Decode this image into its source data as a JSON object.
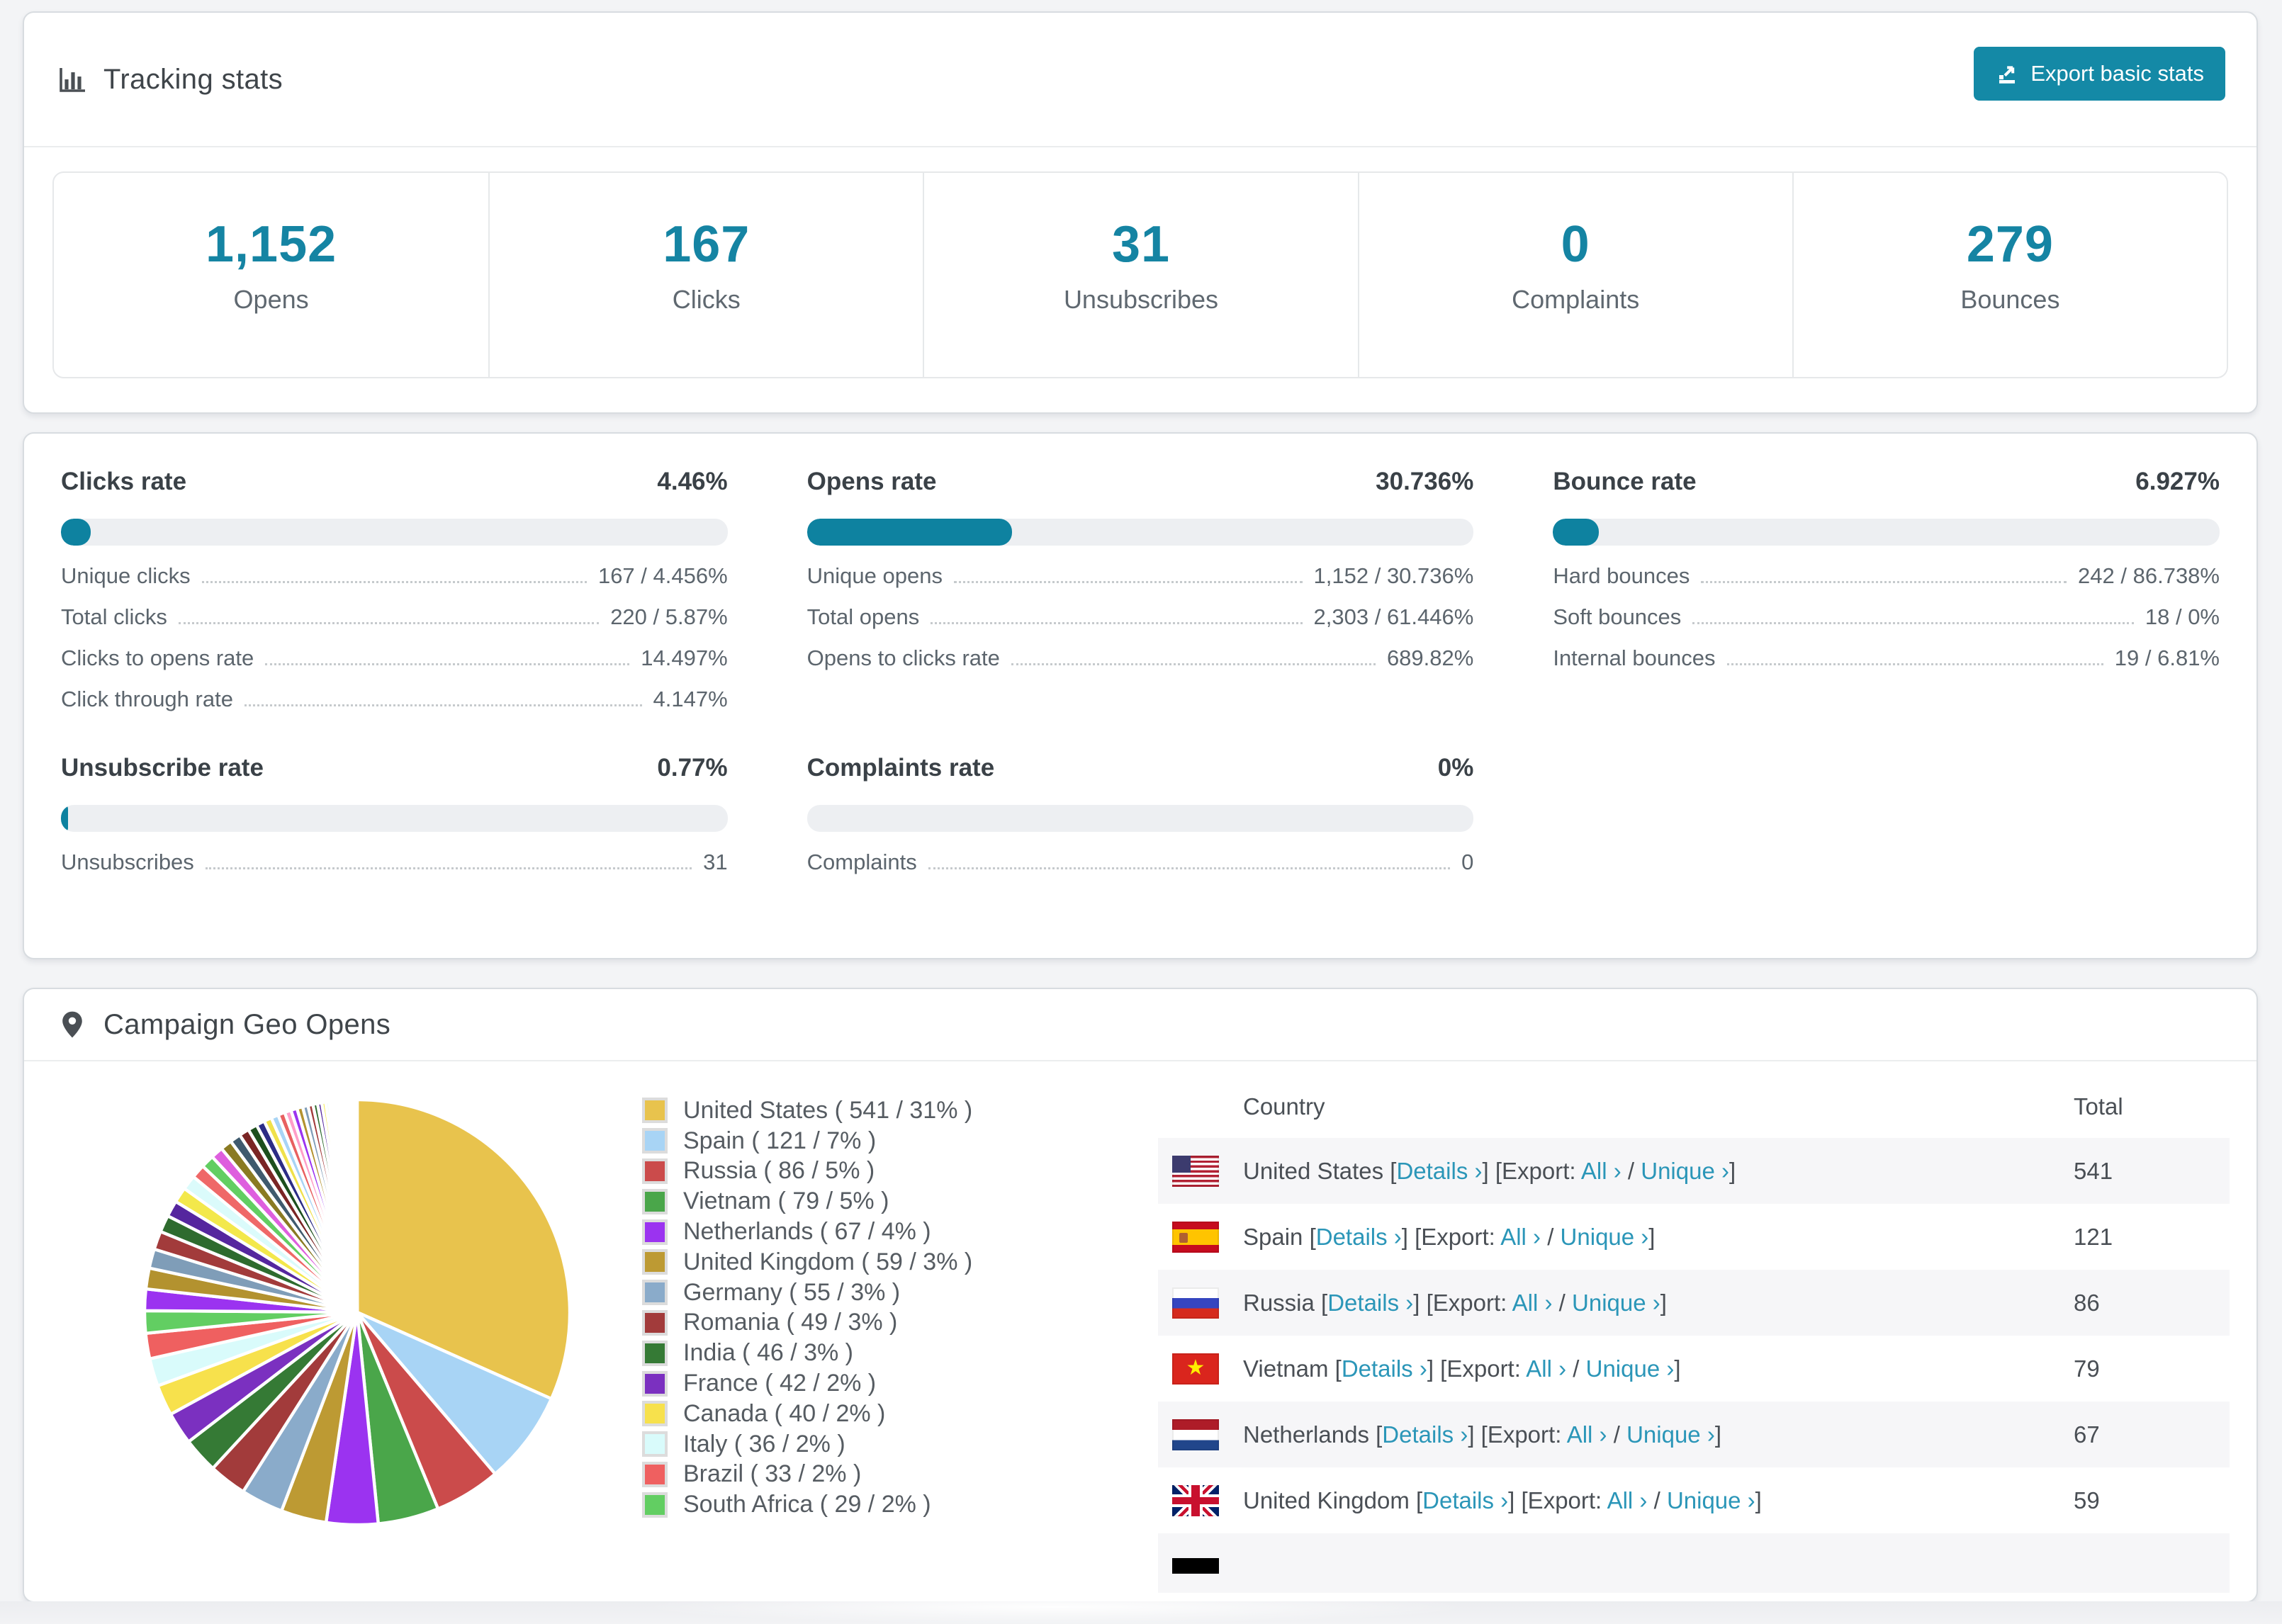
{
  "colors": {
    "accent_teal": "#0e82a0",
    "button_teal": "#1489a6",
    "link_teal": "#2b96b8",
    "stat_number": "#1584a3",
    "bar_track": "#edeff2",
    "row_stripe": "#f6f6f8"
  },
  "icons": {
    "tracking_header": "bar-chart-icon",
    "export_button": "export-icon",
    "geo_header": "map-pin-icon"
  },
  "tracking": {
    "title": "Tracking stats",
    "export_button": "Export basic stats",
    "stats": [
      {
        "value": "1,152",
        "label": "Opens"
      },
      {
        "value": "167",
        "label": "Clicks"
      },
      {
        "value": "31",
        "label": "Unsubscribes"
      },
      {
        "value": "0",
        "label": "Complaints"
      },
      {
        "value": "279",
        "label": "Bounces"
      }
    ]
  },
  "rates": [
    {
      "title": "Clicks rate",
      "value": "4.46%",
      "pct": 4.46,
      "rows": [
        [
          "Unique clicks",
          "167 / 4.456%"
        ],
        [
          "Total clicks",
          "220 / 5.87%"
        ],
        [
          "Clicks to opens rate",
          "14.497%"
        ],
        [
          "Click through rate",
          "4.147%"
        ]
      ]
    },
    {
      "title": "Opens rate",
      "value": "30.736%",
      "pct": 30.736,
      "rows": [
        [
          "Unique opens",
          "1,152 / 30.736%"
        ],
        [
          "Total opens",
          "2,303 / 61.446%"
        ],
        [
          "Opens to clicks rate",
          "689.82%"
        ]
      ]
    },
    {
      "title": "Bounce rate",
      "value": "6.927%",
      "pct": 6.927,
      "rows": [
        [
          "Hard bounces",
          "242 / 86.738%"
        ],
        [
          "Soft bounces",
          "18 / 0%"
        ],
        [
          "Internal bounces",
          "19 / 6.81%"
        ]
      ]
    },
    {
      "title": "Unsubscribe rate",
      "value": "0.77%",
      "pct": 0.77,
      "rows": [
        [
          "Unsubscribes",
          "31"
        ]
      ]
    },
    {
      "title": "Complaints rate",
      "value": "0%",
      "pct": 0,
      "rows": [
        [
          "Complaints",
          "0"
        ]
      ]
    }
  ],
  "geo": {
    "title": "Campaign Geo Opens",
    "table": {
      "headers": [
        "Country",
        "Total"
      ],
      "details_label": "Details ›",
      "export_word": "Export:",
      "all_label": "All ›",
      "unique_label": "Unique ›",
      "rows": [
        {
          "country": "United States",
          "flag": "us",
          "total": "541"
        },
        {
          "country": "Spain",
          "flag": "es",
          "total": "121"
        },
        {
          "country": "Russia",
          "flag": "ru",
          "total": "86"
        },
        {
          "country": "Vietnam",
          "flag": "vn",
          "total": "79"
        },
        {
          "country": "Netherlands",
          "flag": "nl",
          "total": "67"
        },
        {
          "country": "United Kingdom",
          "flag": "gb",
          "total": "59"
        }
      ],
      "partial_row_flag": "de"
    }
  },
  "chart_data": {
    "type": "pie",
    "title": "Campaign Geo Opens",
    "legend_position": "right",
    "start_angle_deg": -90,
    "direction": "clockwise",
    "slices": [
      {
        "label": "United States",
        "value": 541,
        "pct": "31%",
        "color": "#e8c34d",
        "legend": "United States ( 541 / 31% )"
      },
      {
        "label": "Spain",
        "value": 121,
        "pct": "7%",
        "color": "#a8d4f5",
        "legend": "Spain ( 121 / 7% )"
      },
      {
        "label": "Russia",
        "value": 86,
        "pct": "5%",
        "color": "#cb4b4b",
        "legend": "Russia ( 86 / 5% )"
      },
      {
        "label": "Vietnam",
        "value": 79,
        "pct": "5%",
        "color": "#4aa64a",
        "legend": "Vietnam ( 79 / 5% )"
      },
      {
        "label": "Netherlands",
        "value": 67,
        "pct": "4%",
        "color": "#9b33f0",
        "legend": "Netherlands ( 67 / 4% )"
      },
      {
        "label": "United Kingdom",
        "value": 59,
        "pct": "3%",
        "color": "#bd9a33",
        "legend": "United Kingdom ( 59 / 3% )"
      },
      {
        "label": "Germany",
        "value": 55,
        "pct": "3%",
        "color": "#8aabca",
        "legend": "Germany ( 55 / 3% )"
      },
      {
        "label": "Romania",
        "value": 49,
        "pct": "3%",
        "color": "#a23b3b",
        "legend": "Romania ( 49 / 3% )"
      },
      {
        "label": "India",
        "value": 46,
        "pct": "3%",
        "color": "#357a35",
        "legend": "India ( 46 / 3% )"
      },
      {
        "label": "France",
        "value": 42,
        "pct": "2%",
        "color": "#7b30c0",
        "legend": "France ( 42 / 2% )"
      },
      {
        "label": "Canada",
        "value": 40,
        "pct": "2%",
        "color": "#f7e14c",
        "legend": "Canada ( 40 / 2% )"
      },
      {
        "label": "Italy",
        "value": 36,
        "pct": "2%",
        "color": "#d9fbfb",
        "legend": "Italy ( 36 / 2% )"
      },
      {
        "label": "Brazil",
        "value": 33,
        "pct": "2%",
        "color": "#ef6060",
        "legend": "Brazil ( 33 / 2% )"
      },
      {
        "label": "South Africa",
        "value": 29,
        "pct": "2%",
        "color": "#62ce62",
        "legend": "South Africa ( 29 / 2% )"
      }
    ],
    "others_unlabeled": {
      "note": "long tail of small unlabeled country slices fanning into hairlines",
      "values": [
        28,
        27,
        25,
        24,
        22,
        21,
        20,
        19,
        18,
        17,
        16,
        15,
        14,
        13,
        12,
        11,
        10,
        9.5,
        9,
        8.5,
        8,
        7.5,
        7,
        6.5,
        6,
        5.5,
        5,
        4.5,
        4,
        3.5,
        3,
        2.8,
        2.6,
        2.4,
        2.2,
        2,
        1.8,
        1.6,
        1.4,
        1.2,
        1,
        0.9,
        0.8,
        0.8,
        0.7,
        0.7,
        0.6,
        0.6,
        0.5,
        0.5,
        0.5
      ],
      "palette": [
        "#9b33f0",
        "#b3922f",
        "#7f9db8",
        "#a23b3b",
        "#2e6b2e",
        "#55269e",
        "#f3e84b",
        "#dbfbfb",
        "#ef6868",
        "#62ce62",
        "#de5fde",
        "#8a7a22",
        "#3f5a6e",
        "#7a2525",
        "#1d4f1d",
        "#2c2c85",
        "#f0e14a",
        "#a8d4f5",
        "#e86060",
        "#ff9ec8"
      ]
    }
  }
}
